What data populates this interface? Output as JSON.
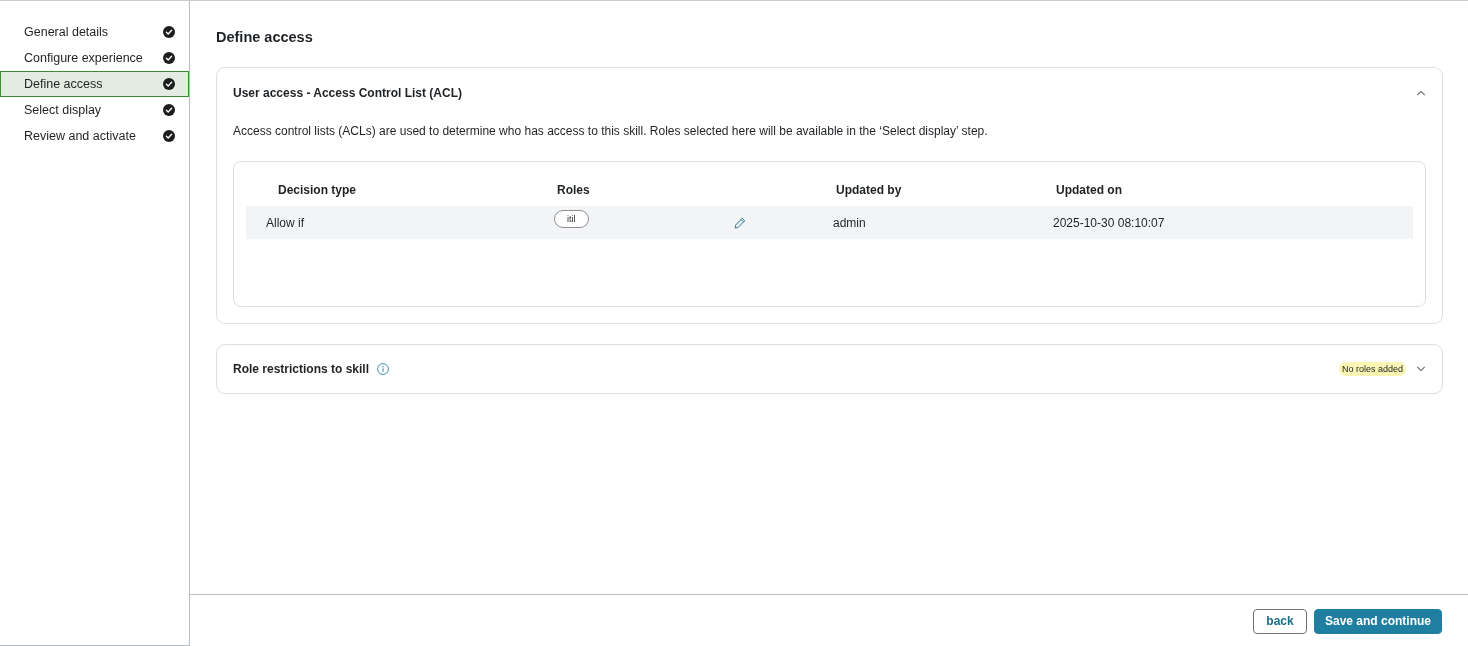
{
  "sidebar": {
    "steps": [
      {
        "label": "General details",
        "completed": true,
        "selected": false
      },
      {
        "label": "Configure experience",
        "completed": true,
        "selected": false
      },
      {
        "label": "Define access",
        "completed": true,
        "selected": true
      },
      {
        "label": "Select display",
        "completed": true,
        "selected": false
      },
      {
        "label": "Review and activate",
        "completed": true,
        "selected": false
      }
    ]
  },
  "page_title": "Define access",
  "sections": [
    {
      "title": "User access - Access Control List (ACL)",
      "expanded": true,
      "info_icon": false,
      "description": "Access control lists (ACLs) are used to determine who has access to this skill. Roles selected here will be available in the ‘Select display’ step.",
      "table": {
        "columns": [
          "Decision type",
          "Roles",
          "Updated by",
          "Updated on"
        ],
        "rows": [
          {
            "decision_type": "Allow if",
            "roles": [
              "itil"
            ],
            "updated_by": "admin",
            "updated_on": "2025-10-30 08:10:07"
          }
        ]
      }
    },
    {
      "title": "Role restrictions to skill",
      "expanded": false,
      "info_icon": true,
      "badge": "No roles added"
    }
  ],
  "footer": {
    "buttons": [
      {
        "label": "back",
        "kind": "secondary"
      },
      {
        "label": "Save and continue",
        "kind": "primary"
      }
    ]
  }
}
